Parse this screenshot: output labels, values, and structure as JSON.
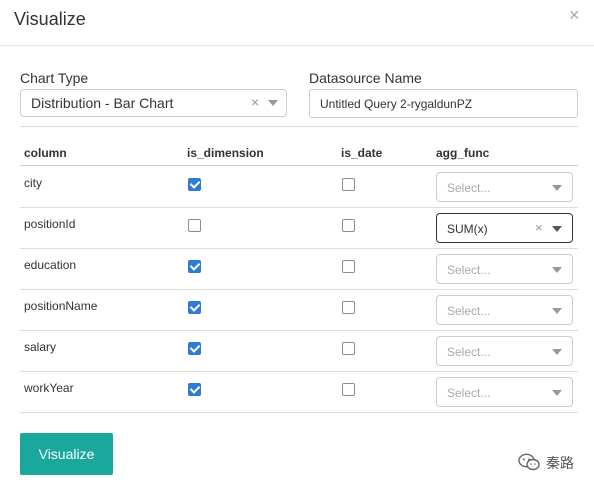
{
  "dialog": {
    "title": "Visualize",
    "close_glyph": "×"
  },
  "form": {
    "chart_type_label": "Chart Type",
    "chart_type_value": "Distribution - Bar Chart",
    "chart_type_clear": "×",
    "datasource_label": "Datasource Name",
    "datasource_value": "Untitled Query 2-rygaldunPZ"
  },
  "table": {
    "headers": [
      "column",
      "is_dimension",
      "is_date",
      "agg_func"
    ],
    "rows": [
      {
        "column": "city",
        "is_dimension": true,
        "is_date": false,
        "agg_func": "",
        "placeholder": "Select..."
      },
      {
        "column": "positionId",
        "is_dimension": false,
        "is_date": false,
        "agg_func": "SUM(x)",
        "placeholder": "Select..."
      },
      {
        "column": "education",
        "is_dimension": true,
        "is_date": false,
        "agg_func": "",
        "placeholder": "Select..."
      },
      {
        "column": "positionName",
        "is_dimension": true,
        "is_date": false,
        "agg_func": "",
        "placeholder": "Select..."
      },
      {
        "column": "salary",
        "is_dimension": true,
        "is_date": false,
        "agg_func": "",
        "placeholder": "Select..."
      },
      {
        "column": "workYear",
        "is_dimension": true,
        "is_date": false,
        "agg_func": "",
        "placeholder": "Select..."
      }
    ]
  },
  "footer": {
    "visualize_button": "Visualize"
  },
  "watermark": {
    "text": "秦路",
    "icon": "wechat-icon"
  },
  "colors": {
    "accent": "#1aa89c",
    "checkbox": "#2d7bd6"
  }
}
